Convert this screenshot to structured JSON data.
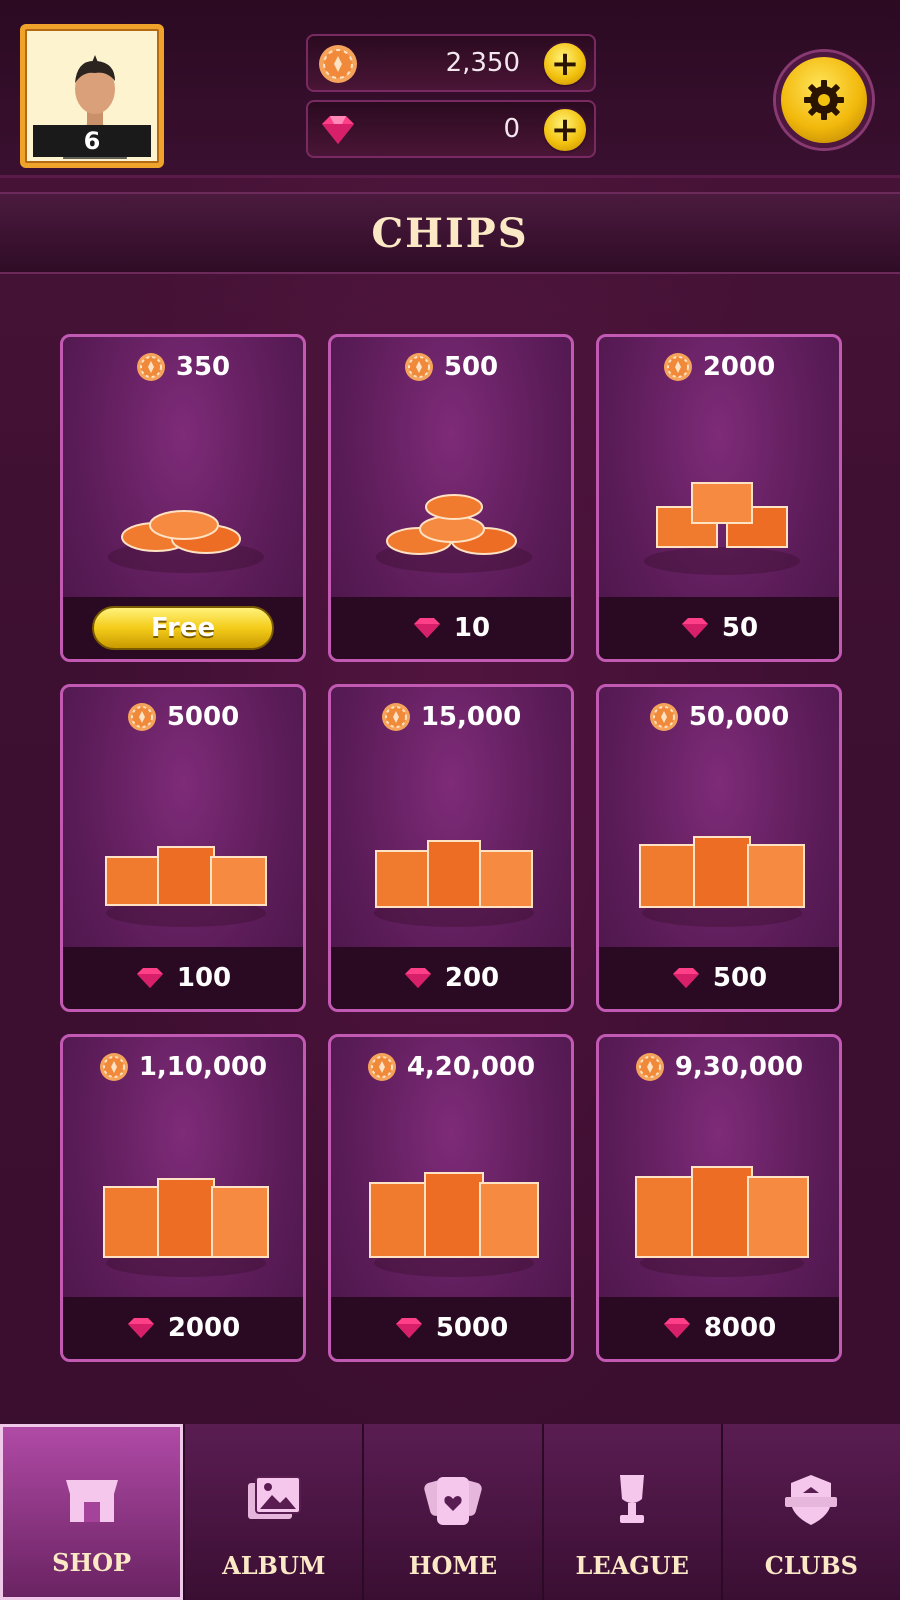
{
  "header": {
    "player_level": "6",
    "chips_balance": "2,350",
    "gems_balance": "0",
    "plus_label": "+"
  },
  "title": "CHIPS",
  "cards": [
    {
      "amount": "350",
      "price": "Free",
      "free": true
    },
    {
      "amount": "500",
      "price": "10"
    },
    {
      "amount": "2000",
      "price": "50"
    },
    {
      "amount": "5000",
      "price": "100"
    },
    {
      "amount": "15,000",
      "price": "200"
    },
    {
      "amount": "50,000",
      "price": "500"
    },
    {
      "amount": "1,10,000",
      "price": "2000"
    },
    {
      "amount": "4,20,000",
      "price": "5000"
    },
    {
      "amount": "9,30,000",
      "price": "8000"
    }
  ],
  "nav": {
    "items": [
      {
        "label": "SHOP",
        "icon": "shop-icon",
        "active": true
      },
      {
        "label": "ALBUM",
        "icon": "album-icon"
      },
      {
        "label": "HOME",
        "icon": "home-cards-icon"
      },
      {
        "label": "LEAGUE",
        "icon": "trophy-icon"
      },
      {
        "label": "CLUBS",
        "icon": "clubs-shield-icon"
      }
    ]
  },
  "colors": {
    "accent_gold": "#f2c20f",
    "chip_orange": "#f07a2e",
    "gem_pink": "#ff3f88",
    "card_border": "#c25ab4",
    "background": "#3a0f2e"
  }
}
